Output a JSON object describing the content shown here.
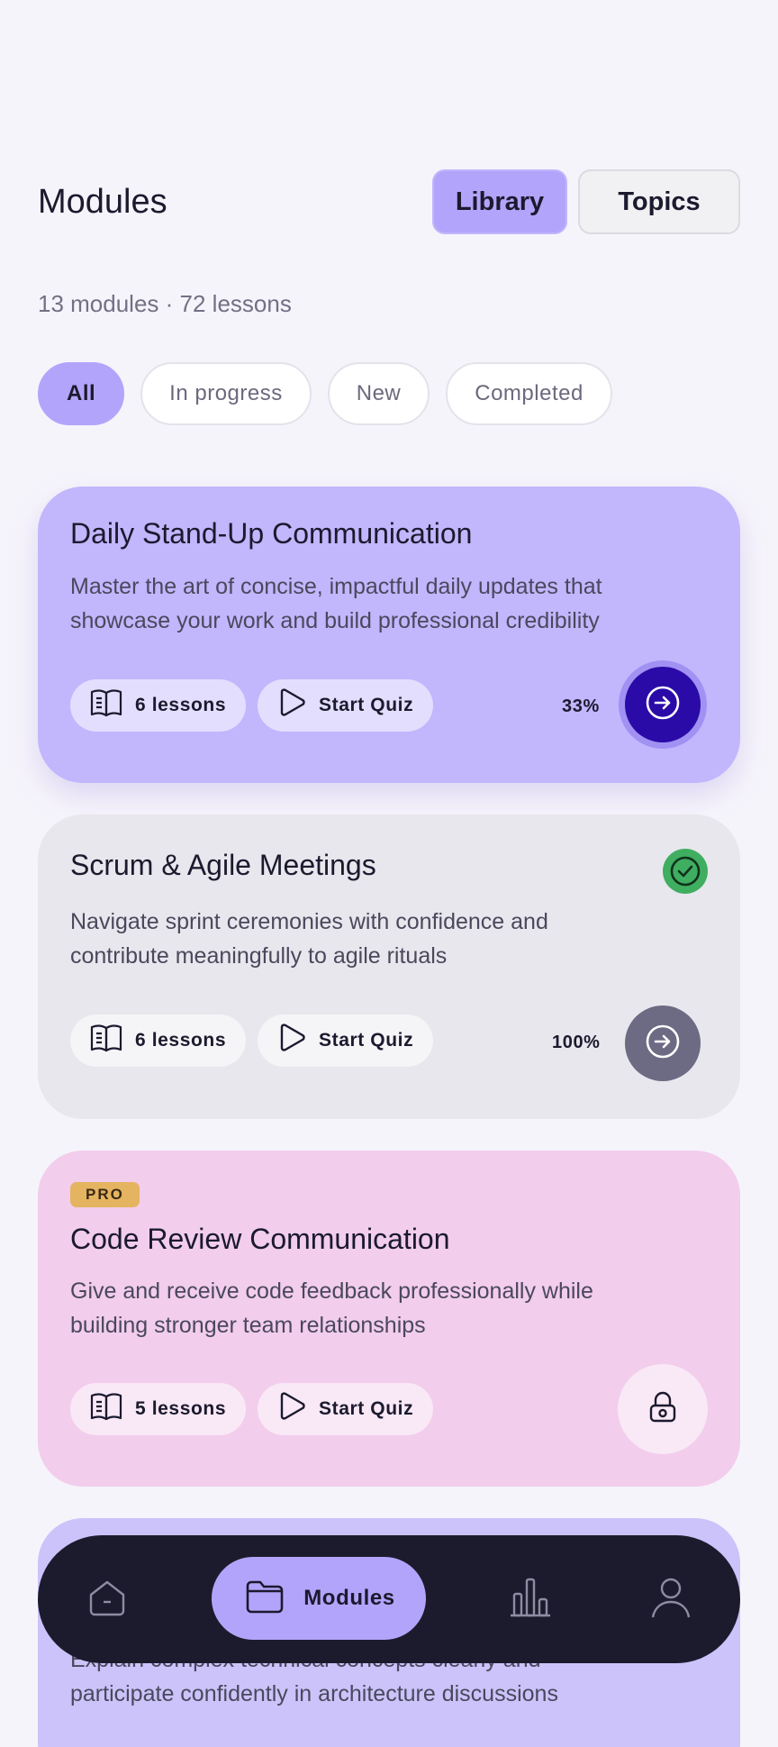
{
  "header": {
    "title": "Modules"
  },
  "segmented": {
    "library": "Library",
    "topics": "Topics"
  },
  "summary": "13 modules · 72 lessons",
  "filters": [
    "All",
    "In progress",
    "New",
    "Completed"
  ],
  "cards": [
    {
      "title": "Daily Stand-Up Communication",
      "desc_line1": "Master the art of concise, impactful daily updates that",
      "desc_line2": "showcase your work and build professional credibility",
      "lessons": "6 lessons",
      "quiz": "Start Quiz",
      "progress": "33%"
    },
    {
      "title": "Scrum & Agile Meetings",
      "desc_line1": "Navigate sprint ceremonies with confidence and",
      "desc_line2": "contribute meaningfully to agile rituals",
      "lessons": "6 lessons",
      "quiz": "Start Quiz",
      "progress": "100%"
    },
    {
      "badge": "PRO",
      "title": "Code Review Communication",
      "desc_line1": "Give and receive code feedback professionally while",
      "desc_line2": "building stronger team relationships",
      "lessons": "5 lessons",
      "quiz": "Start Quiz"
    },
    {
      "desc_line1": "Explain complex technical concepts clearly and",
      "desc_line2": "participate confidently in architecture discussions"
    }
  ],
  "nav": {
    "active_label": "Modules"
  },
  "colors": {
    "accent": "#b3a4fb",
    "primary_button": "#2a0ba8",
    "completed_green": "#3fae60",
    "pro_badge": "#e4b460",
    "nav_bg": "#1c1b2d"
  },
  "icons": [
    "book-icon",
    "play-icon",
    "arrow-right-circle-icon",
    "check-circle-icon",
    "lock-icon",
    "home-icon",
    "folder-icon",
    "bar-chart-icon",
    "user-icon"
  ]
}
